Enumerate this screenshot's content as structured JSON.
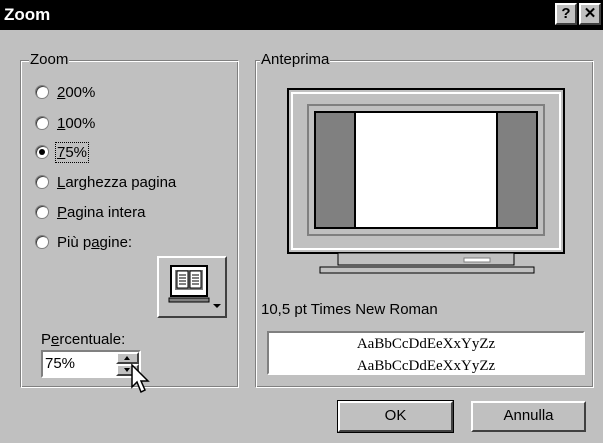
{
  "window": {
    "title": "Zoom",
    "help_label": "?",
    "close_label": "✕"
  },
  "zoom_group": {
    "legend": "Zoom",
    "options": [
      {
        "pre": "",
        "key": "2",
        "post": "00%",
        "selected": false
      },
      {
        "pre": "",
        "key": "1",
        "post": "00%",
        "selected": false
      },
      {
        "pre": "",
        "key": "7",
        "post": "5%",
        "selected": true
      },
      {
        "pre": "",
        "key": "L",
        "post": "arghezza pagina",
        "selected": false
      },
      {
        "pre": "",
        "key": "P",
        "post": "agina intera",
        "selected": false
      },
      {
        "pre": "Più p",
        "key": "a",
        "post": "gine:",
        "selected": false
      }
    ],
    "percent_label_pre": "P",
    "percent_label_key": "e",
    "percent_label_post": "rcentuale:",
    "percent_value": "75%"
  },
  "preview_group": {
    "legend": "Anteprima",
    "font_legend": "10,5 pt Times New Roman",
    "sample_line1": "AaBbCcDdEeXxYyZz",
    "sample_line2": "AaBbCcDdEeXxYyZz"
  },
  "buttons": {
    "ok": "OK",
    "cancel": "Annulla"
  },
  "icons": [
    "help-icon",
    "close-icon",
    "monitor-pages-icon",
    "spin-up-icon",
    "spin-down-icon",
    "mouse-cursor-icon"
  ]
}
